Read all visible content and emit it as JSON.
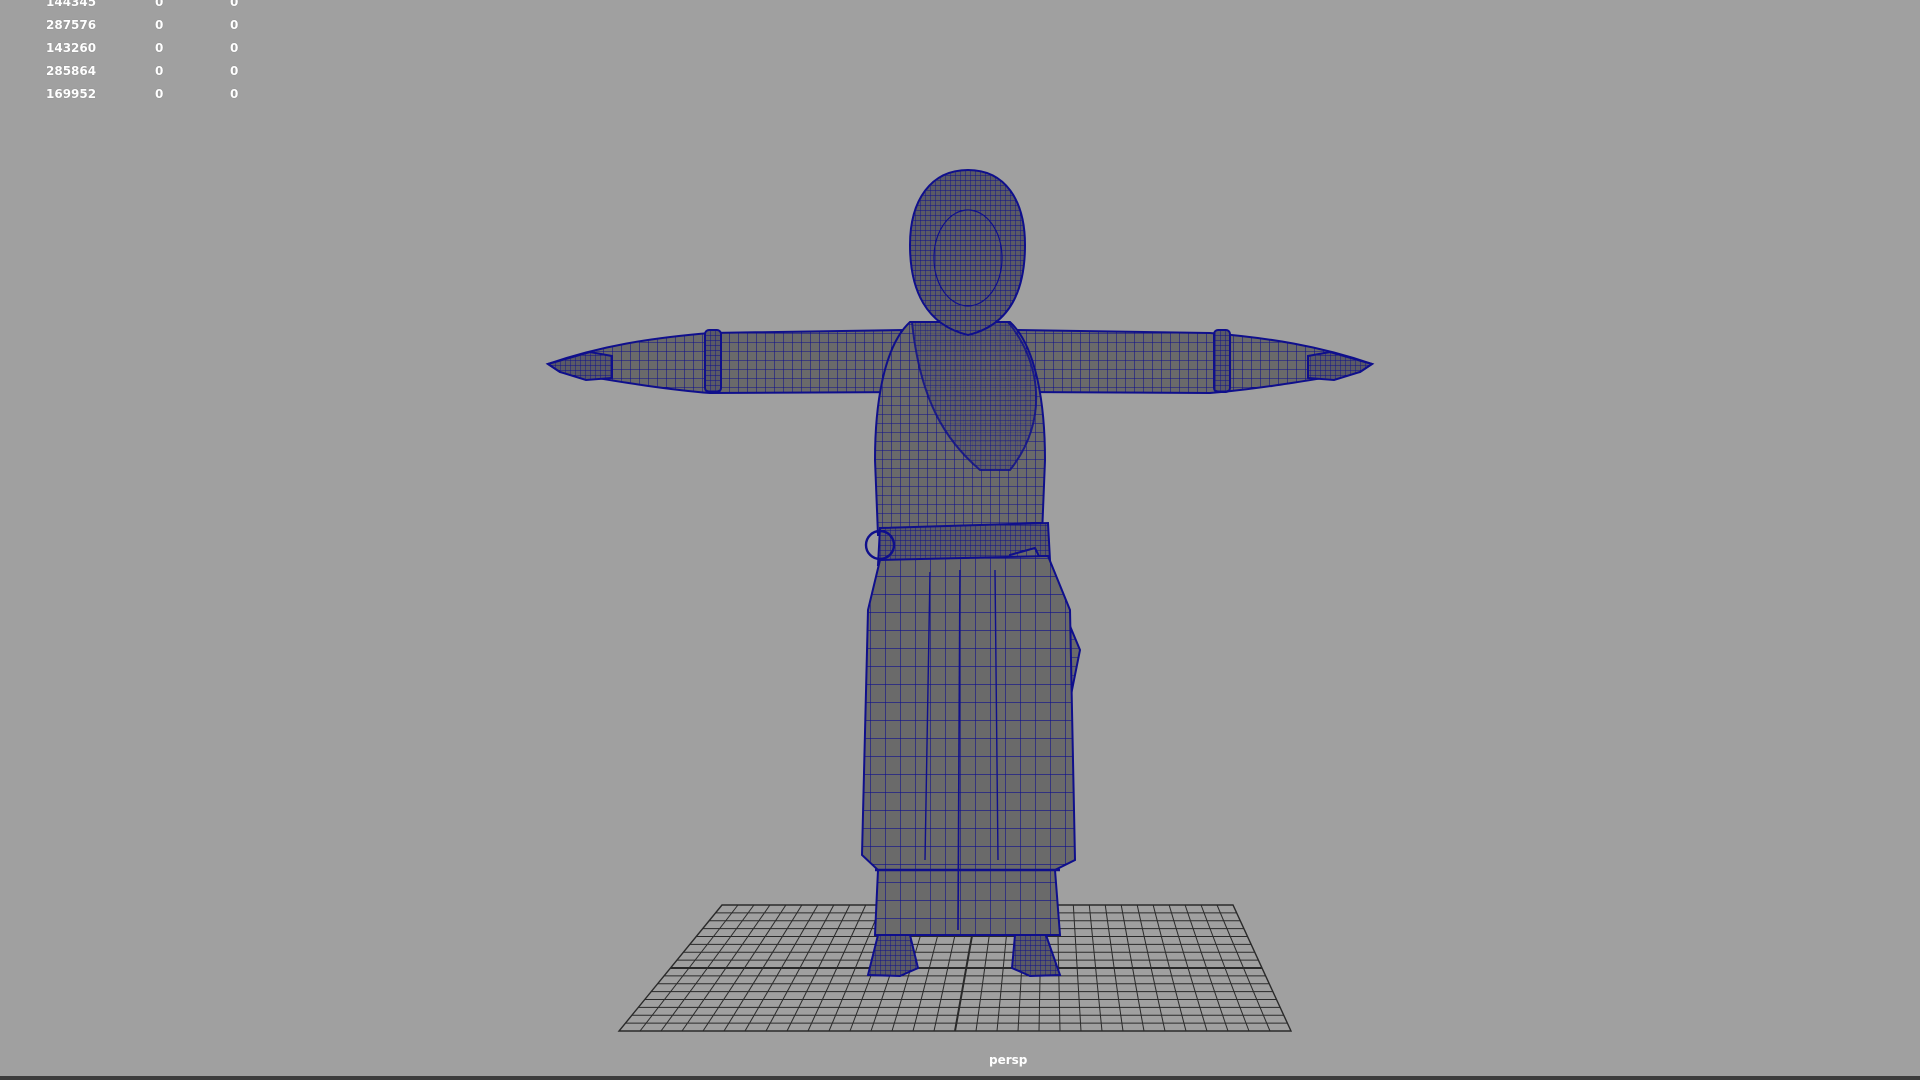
{
  "viewport": {
    "camera": "persp",
    "background_color": "#a0a0a0",
    "wireframe_color": "#0f0f8c",
    "shade_color": "#6a6a6a",
    "grid_color": "#2a2a2a"
  },
  "hud": {
    "rows": [
      {
        "c1": "144345",
        "c2": "0",
        "c3": "0"
      },
      {
        "c1": "287576",
        "c2": "0",
        "c3": "0"
      },
      {
        "c1": "143260",
        "c2": "0",
        "c3": "0"
      },
      {
        "c1": "285864",
        "c2": "0",
        "c3": "0"
      },
      {
        "c1": "169952",
        "c2": "0",
        "c3": "0"
      }
    ]
  },
  "scene": {
    "model_icon": "wireframe-character-model-icon",
    "grid_icon": "ground-grid-icon"
  }
}
